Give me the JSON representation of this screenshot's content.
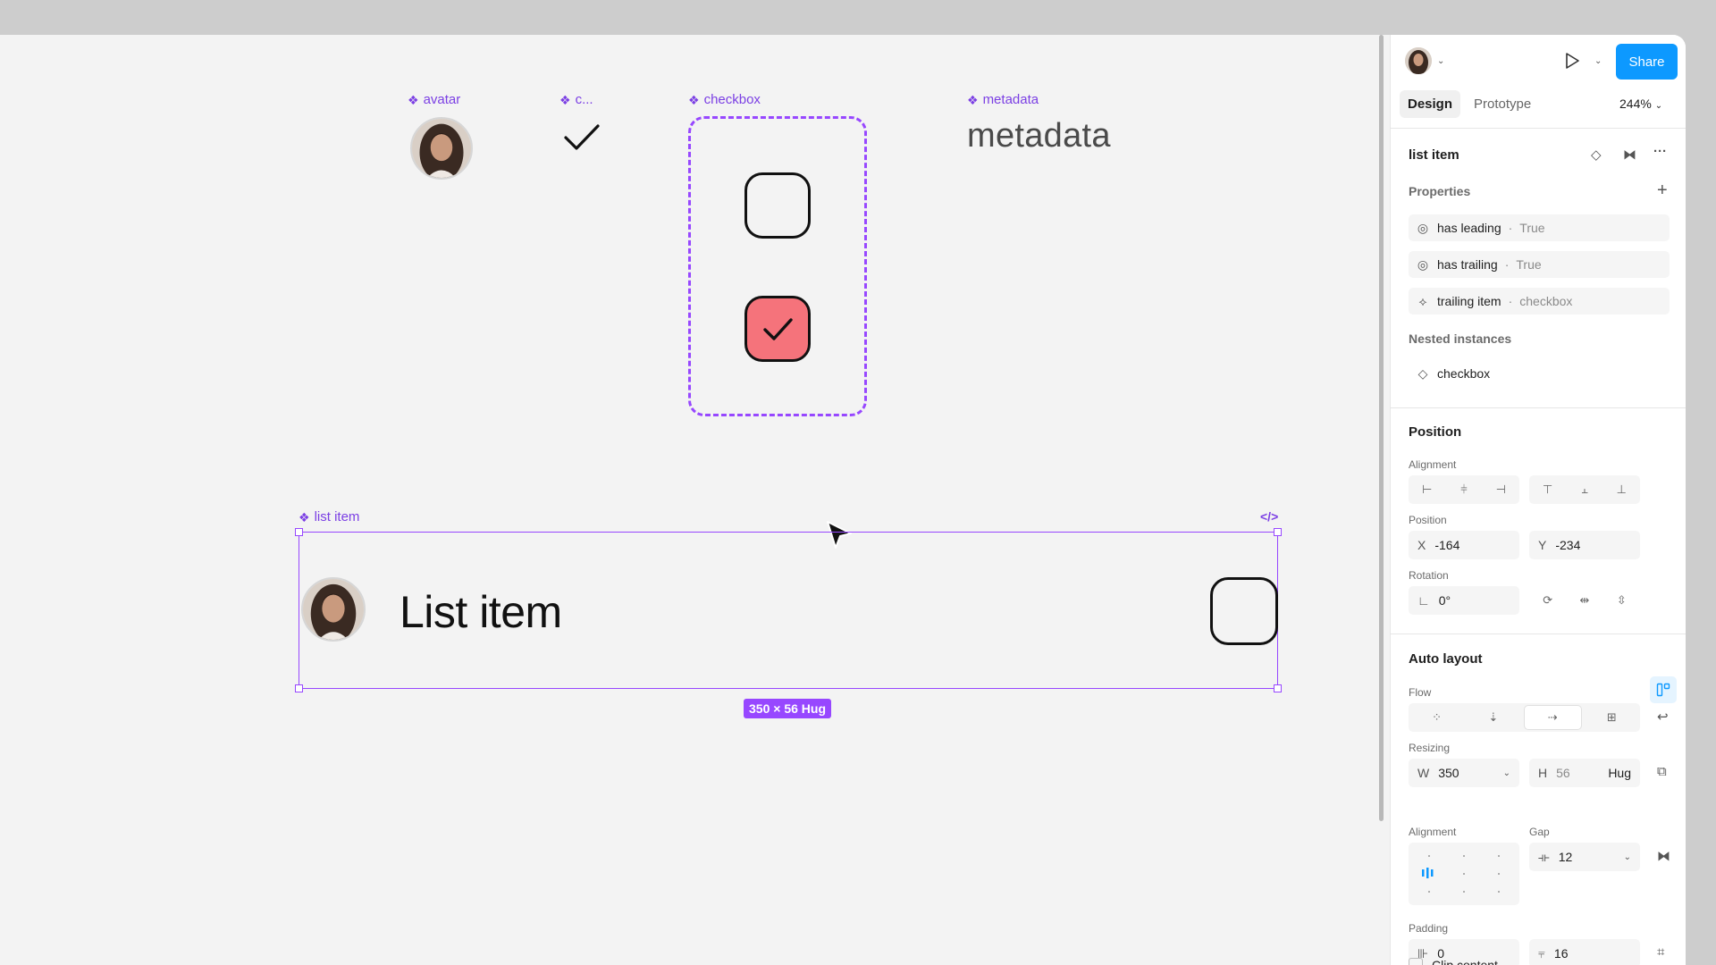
{
  "canvas": {
    "components": {
      "avatar_label": "avatar",
      "check_label": "c...",
      "checkbox_label": "checkbox",
      "metadata_label": "metadata",
      "metadata_text": "metadata",
      "list_item_label": "list item",
      "list_item_title": "List item",
      "size_badge": "350 × 56 Hug",
      "code_icon": "</>"
    },
    "checkbox_states": [
      "unchecked",
      "checked"
    ],
    "colors": {
      "selection": "#9747ff",
      "checked_fill": "#f5737b",
      "canvas_bg": "#f3f3f3"
    }
  },
  "panel": {
    "share_label": "Share",
    "tabs": [
      "Design",
      "Prototype"
    ],
    "active_tab": "Design",
    "zoom": "244%",
    "layer_name": "list item",
    "properties": {
      "title": "Properties",
      "items": [
        {
          "name": "has leading",
          "value": "True",
          "icon": "eye-toggle-icon"
        },
        {
          "name": "has trailing",
          "value": "True",
          "icon": "eye-toggle-icon"
        },
        {
          "name": "trailing item",
          "value": "checkbox",
          "icon": "instance-swap-icon"
        }
      ]
    },
    "nested_instances": {
      "title": "Nested instances",
      "items": [
        "checkbox"
      ]
    },
    "position": {
      "title": "Position",
      "alignment_label": "Alignment",
      "position_label": "Position",
      "x_prefix": "X",
      "x": "-164",
      "y_prefix": "Y",
      "y": "-234",
      "rotation_label": "Rotation",
      "rotation": "0°"
    },
    "auto_layout": {
      "title": "Auto layout",
      "flow_label": "Flow",
      "resizing_label": "Resizing",
      "w_prefix": "W",
      "w": "350",
      "h_prefix": "H",
      "h": "56",
      "h_mode": "Hug",
      "alignment_label": "Alignment",
      "gap_label": "Gap",
      "gap": "12",
      "padding_label": "Padding",
      "padding_h": "0",
      "padding_v": "16",
      "clip_label": "Clip content"
    },
    "accent": "#0d99ff"
  }
}
